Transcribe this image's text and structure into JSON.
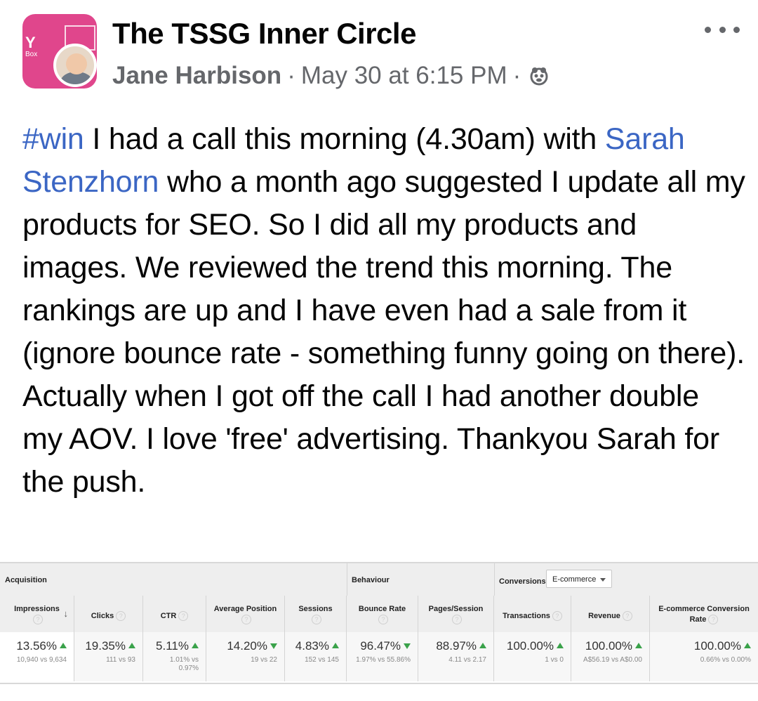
{
  "header": {
    "group_name": "The TSSG Inner Circle",
    "author": "Jane Harbison",
    "separator": "·",
    "timestamp": "May 30 at 6:15 PM",
    "thumb_text_1": "Y",
    "thumb_text_2": "Box"
  },
  "post": {
    "hashtag": "#win",
    "text_1": " I had a call this morning (4.30am) with ",
    "mention": "Sarah Stenzhorn",
    "text_2": " who a month ago suggested I update all my products for SEO. So I did all my products and images. We reviewed the trend this morning. The rankings are up and I have even had a sale from it (ignore bounce rate - something funny going on there). Actually when I got off the call I had another double my AOV. I love 'free' advertising. Thankyou Sarah for the push."
  },
  "analytics": {
    "sections": {
      "acquisition": "Acquisition",
      "behaviour": "Behaviour",
      "conversions": "Conversions",
      "conversions_dropdown": "E-commerce"
    },
    "columns": [
      {
        "name": "Impressions",
        "pct": "13.56%",
        "cmp": "10,940 vs 9,634",
        "trend": "up"
      },
      {
        "name": "Clicks",
        "pct": "19.35%",
        "cmp": "111 vs 93",
        "trend": "up"
      },
      {
        "name": "CTR",
        "pct": "5.11%",
        "cmp": "1.01% vs 0.97%",
        "trend": "up"
      },
      {
        "name": "Average Position",
        "pct": "14.20%",
        "cmp": "19 vs 22",
        "trend": "down"
      },
      {
        "name": "Sessions",
        "pct": "4.83%",
        "cmp": "152 vs 145",
        "trend": "up"
      },
      {
        "name": "Bounce Rate",
        "pct": "96.47%",
        "cmp": "1.97% vs 55.86%",
        "trend": "down"
      },
      {
        "name": "Pages/Session",
        "pct": "88.97%",
        "cmp": "4.11 vs 2.17",
        "trend": "up"
      },
      {
        "name": "Transactions",
        "pct": "100.00%",
        "cmp": "1 vs 0",
        "trend": "up"
      },
      {
        "name": "Revenue",
        "pct": "100.00%",
        "cmp": "A$56.19 vs A$0.00",
        "trend": "up"
      },
      {
        "name": "E-commerce Conversion Rate",
        "pct": "100.00%",
        "cmp": "0.66% vs 0.00%",
        "trend": "up"
      }
    ],
    "help_glyph": "?",
    "sort_glyph": "↓"
  },
  "colors": {
    "link": "#3b66c4",
    "meta_gray": "#65676b",
    "trend_green": "#3aa24a",
    "group_thumb": "#e0468c"
  }
}
